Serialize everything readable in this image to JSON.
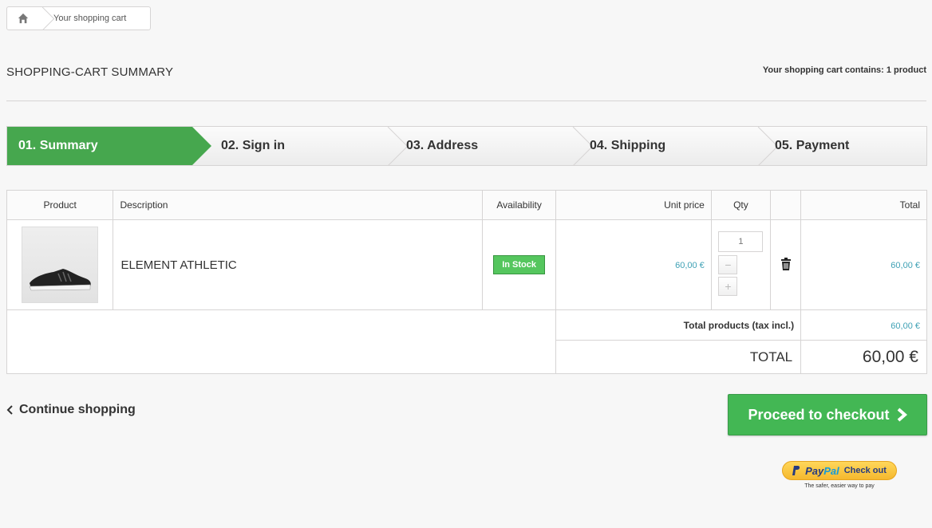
{
  "breadcrumb": {
    "current": "Your shopping cart"
  },
  "heading": {
    "title": "SHOPPING-CART SUMMARY",
    "cart_count": "Your shopping cart contains: 1 product"
  },
  "steps": [
    "01. Summary",
    "02. Sign in",
    "03. Address",
    "04. Shipping",
    "05. Payment"
  ],
  "table": {
    "headers": {
      "product": "Product",
      "description": "Description",
      "availability": "Availability",
      "unit_price": "Unit price",
      "qty": "Qty",
      "total": "Total"
    },
    "items": [
      {
        "name": "ELEMENT ATHLETIC",
        "availability": "In Stock",
        "unit_price": "60,00 €",
        "qty": "1",
        "total": "60,00 €"
      }
    ],
    "totals": {
      "products_label": "Total products (tax incl.)",
      "products_value": "60,00 €",
      "total_label": "TOTAL",
      "total_value": "60,00 €"
    }
  },
  "actions": {
    "continue": "Continue shopping",
    "checkout": "Proceed to checkout"
  },
  "paypal": {
    "logo_a": "Pay",
    "logo_b": "Pal",
    "button": "Check out",
    "tagline": "The safer, easier way to pay"
  },
  "colors": {
    "accent_green": "#46a74e",
    "price_blue": "#3fa1b5"
  },
  "icons": [
    "home-icon",
    "trash-icon",
    "chevron-left-icon",
    "chevron-right-icon",
    "paypal-icon"
  ]
}
